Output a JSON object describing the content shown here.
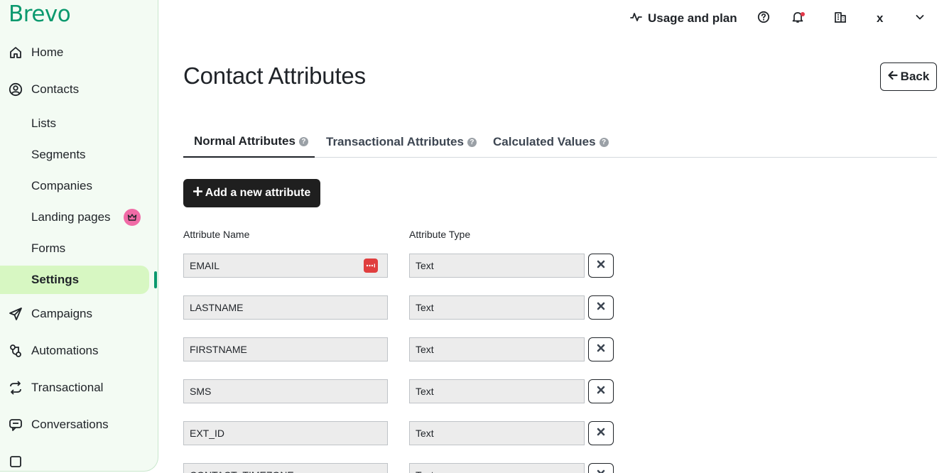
{
  "brand": {
    "logo_text": "Brevo",
    "accent": "#0b996e",
    "active_bg": "#d7f7c2"
  },
  "sidebar": {
    "items": [
      {
        "label": "Home",
        "icon": "home-icon"
      },
      {
        "label": "Contacts",
        "icon": "contacts-icon"
      },
      {
        "label": "Lists"
      },
      {
        "label": "Segments"
      },
      {
        "label": "Companies"
      },
      {
        "label": "Landing pages",
        "badge_icon": "crown-icon"
      },
      {
        "label": "Forms"
      },
      {
        "label": "Settings",
        "active": true
      },
      {
        "label": "Campaigns",
        "icon": "send-icon"
      },
      {
        "label": "Automations",
        "icon": "automation-icon"
      },
      {
        "label": "Transactional",
        "icon": "transactional-icon"
      },
      {
        "label": "Conversations",
        "icon": "chat-icon"
      }
    ]
  },
  "header": {
    "usage_label": "Usage and plan",
    "account_label": "x"
  },
  "page": {
    "title": "Contact Attributes",
    "back_label": "Back"
  },
  "tabs": [
    {
      "label": "Normal Attributes",
      "active": true
    },
    {
      "label": "Transactional Attributes"
    },
    {
      "label": "Calculated Values"
    }
  ],
  "add_button_label": "Add a new attribute",
  "table": {
    "headers": {
      "name": "Attribute Name",
      "type": "Attribute Type"
    },
    "rows": [
      {
        "name": "EMAIL",
        "type": "Text"
      },
      {
        "name": "LASTNAME",
        "type": "Text"
      },
      {
        "name": "FIRSTNAME",
        "type": "Text"
      },
      {
        "name": "SMS",
        "type": "Text"
      },
      {
        "name": "EXT_ID",
        "type": "Text"
      },
      {
        "name": "CONTACT_TIMEZONE",
        "type": "Text"
      }
    ]
  }
}
